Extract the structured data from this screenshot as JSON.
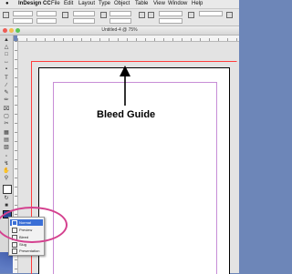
{
  "menubar": {
    "app_name": "InDesign CC",
    "items": [
      "File",
      "Edit",
      "Layout",
      "Type",
      "Object",
      "Table",
      "View",
      "Window",
      "Help"
    ]
  },
  "document": {
    "title": "Untitled-4 @ 75%"
  },
  "annotation": {
    "bleed_label": "Bleed Guide"
  },
  "screen_mode_menu": {
    "options": [
      "Normal",
      "Preview",
      "Bleed",
      "Slug",
      "Presentation"
    ],
    "selected": "Normal"
  },
  "colors": {
    "bleed_guide": "#ff3b3b",
    "margin_guide": "#c78dd6",
    "highlight": "#d4418f",
    "selection": "#3b6fd6"
  }
}
